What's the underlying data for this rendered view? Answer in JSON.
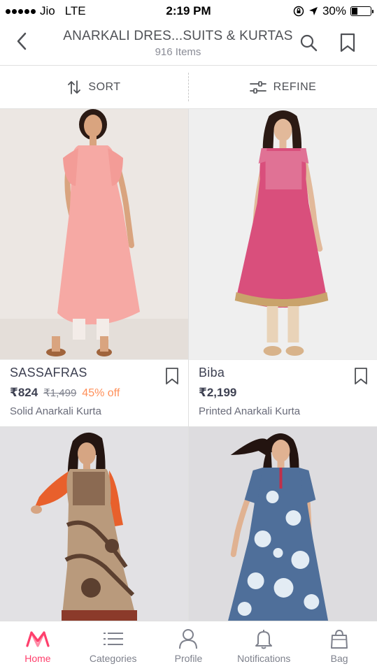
{
  "status_bar": {
    "carrier": "Jio",
    "network": "LTE",
    "time": "2:19 PM",
    "battery": "30%",
    "battery_level": 0.3
  },
  "header": {
    "title": "ANARKALI DRES...SUITS & KURTAS",
    "subtitle": "916 Items"
  },
  "actions": {
    "sort_label": "SORT",
    "refine_label": "REFINE"
  },
  "products": [
    {
      "brand": "SASSAFRAS",
      "price": "₹824",
      "mrp": "₹1,499",
      "discount": "45% off",
      "name": "Solid Anarkali Kurta",
      "dress_color": "#f6a9a4",
      "bg_color": "#ece7e3"
    },
    {
      "brand": "Biba",
      "price": "₹2,199",
      "mrp": "",
      "discount": "",
      "name": "Printed Anarkali Kurta",
      "dress_color": "#d94f7c",
      "bg_color": "#efefef"
    },
    {
      "brand": "",
      "price": "",
      "name": "",
      "dress_color": "#b99a7c",
      "bg_color": "#e2e1e4"
    },
    {
      "brand": "",
      "price": "",
      "name": "",
      "dress_color": "#4f6f9a",
      "bg_color": "#dddcdf"
    }
  ],
  "nav": {
    "home": "Home",
    "categories": "Categories",
    "profile": "Profile",
    "notifications": "Notifications",
    "bag": "Bag"
  },
  "colors": {
    "accent": "#ff3f6c",
    "discount": "#ff905a",
    "text": "#3e4152"
  }
}
